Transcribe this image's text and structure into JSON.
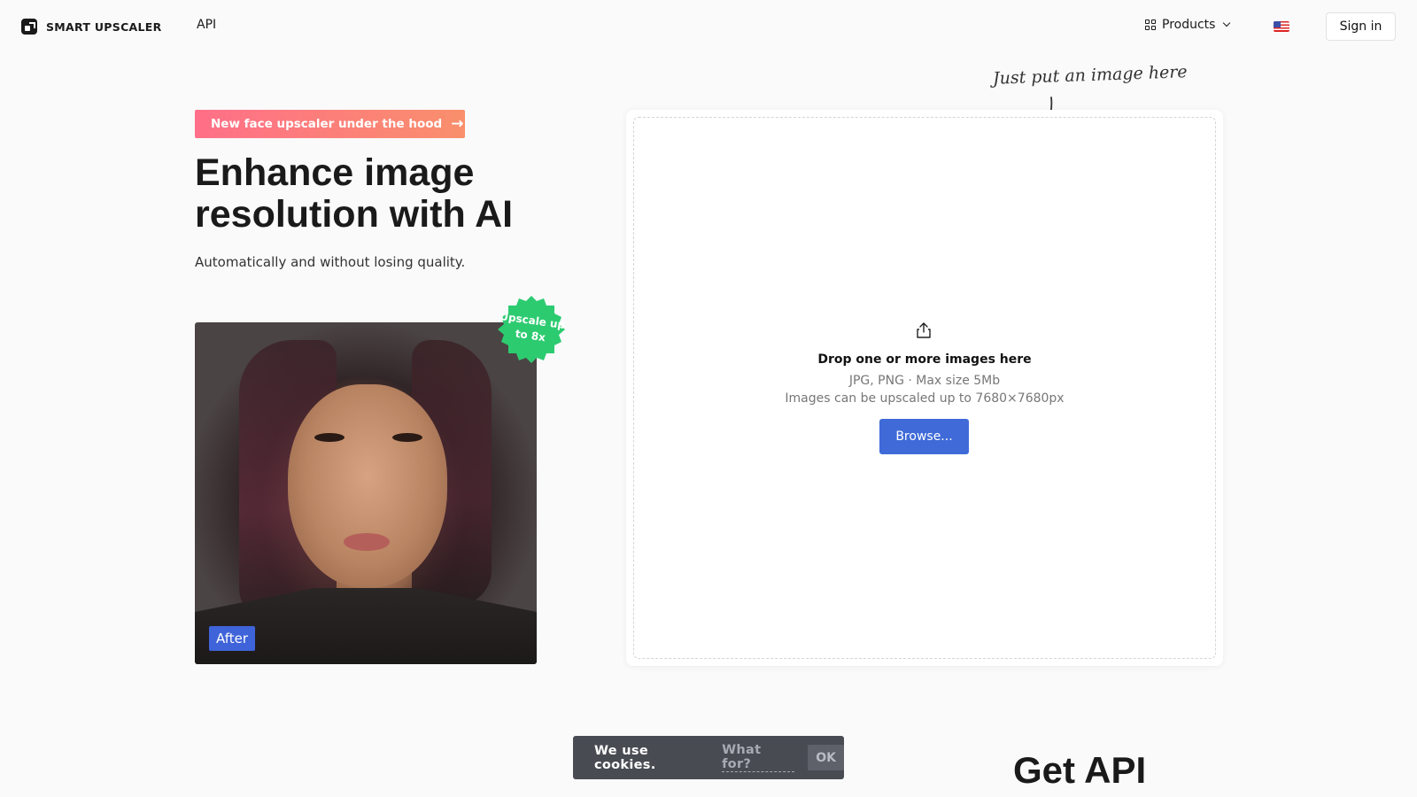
{
  "header": {
    "logo_text": "SMART UPSCALER",
    "nav_api": "API",
    "products_label": "Products",
    "sign_in": "Sign in"
  },
  "hero": {
    "promo": "New face upscaler under the hood",
    "title": "Enhance image resolution with AI",
    "subtitle": "Automatically and without losing quality.",
    "seal_text": "Upscale up to 8x",
    "after_label": "After"
  },
  "dropzone": {
    "hint": "Just put an image here",
    "title": "Drop one or more images here",
    "formats": "JPG, PNG · Max size 5Mb",
    "limit": "Images can be upscaled up to 7680×7680px",
    "browse": "Browse..."
  },
  "cookies": {
    "text": "We use cookies.",
    "link": "What for?",
    "ok": "OK"
  },
  "section": {
    "get_api": "Get API"
  },
  "colors": {
    "accent_blue": "#3f6ad8",
    "promo_gradient_start": "#ff6f88",
    "promo_gradient_end": "#f98f6c",
    "seal_green": "#2dcb70",
    "cookie_bg": "#484b52"
  }
}
